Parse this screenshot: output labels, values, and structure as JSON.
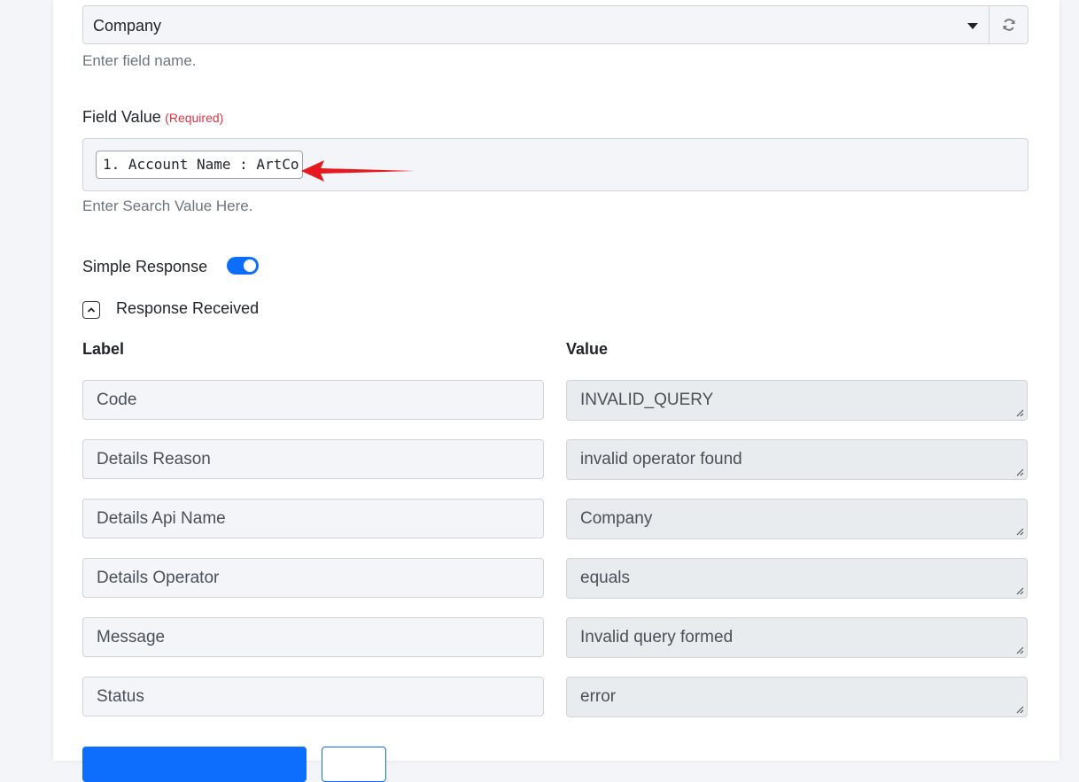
{
  "field_name": {
    "selected": "Company",
    "help": "Enter field name."
  },
  "field_value": {
    "label": "Field Value",
    "required": "(Required)",
    "tag": "1. Account Name : ArtCo",
    "help": "Enter Search Value Here."
  },
  "simple_response": {
    "label": "Simple Response",
    "enabled": true
  },
  "response_received": {
    "label": "Response Received",
    "columns": {
      "label": "Label",
      "value": "Value"
    },
    "rows": [
      {
        "label": "Code",
        "value": "INVALID_QUERY"
      },
      {
        "label": "Details Reason",
        "value": "invalid operator found"
      },
      {
        "label": "Details Api Name",
        "value": "Company"
      },
      {
        "label": "Details Operator",
        "value": "equals"
      },
      {
        "label": "Message",
        "value": "Invalid query formed"
      },
      {
        "label": "Status",
        "value": "error"
      }
    ]
  },
  "colors": {
    "primary": "#0d6efd",
    "required": "#dc3545",
    "annotation_arrow": "#e5191f"
  }
}
